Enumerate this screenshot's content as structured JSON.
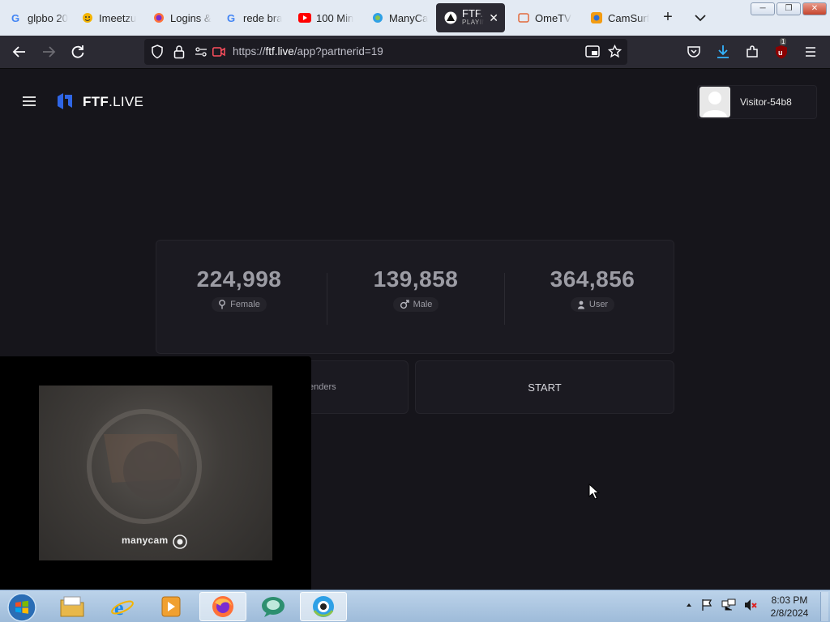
{
  "browser": {
    "tabs": [
      {
        "title": "glpbo 20",
        "icon": "google-icon"
      },
      {
        "title": "Imeetzu",
        "icon": "imeetzu-icon"
      },
      {
        "title": "Logins &",
        "icon": "firefox-icon"
      },
      {
        "title": "rede bra",
        "icon": "google-icon"
      },
      {
        "title": "100 Min",
        "icon": "youtube-icon"
      },
      {
        "title": "ManyCa",
        "icon": "manycam-icon"
      },
      {
        "title": "FTF.li",
        "subtitle": "PLAYING",
        "icon": "ftf-icon",
        "active": true
      },
      {
        "title": "OmeTV",
        "icon": "ometv-icon"
      },
      {
        "title": "CamSurf",
        "icon": "camsurf-icon"
      }
    ],
    "new_tab_label": "+",
    "tab_close_label": "✕",
    "url_prefix": "https://",
    "url_host": "ftf.live",
    "url_path": "/app?partnerid=19",
    "extension_badge": "1",
    "window_controls": {
      "minimize": "─",
      "restore": "❐",
      "close": "✕"
    }
  },
  "app": {
    "logo_bold": "FTF",
    "logo_rest": ".LIVE",
    "visitor_name": "Visitor-54b8",
    "stats": [
      {
        "value": "224,998",
        "label": "Female",
        "icon": "female-icon"
      },
      {
        "value": "139,858",
        "label": "Male",
        "icon": "male-icon"
      },
      {
        "value": "364,856",
        "label": "User",
        "icon": "user-icon"
      }
    ],
    "genders_button_partial": "enders",
    "start_label": "START"
  },
  "video": {
    "watermark": "manycam"
  },
  "taskbar": {
    "time": "8:03 PM",
    "date": "2/8/2024",
    "items": [
      "explorer-icon",
      "ie-icon",
      "media-player-icon",
      "firefox-icon",
      "chat-icon",
      "manycam-icon"
    ]
  },
  "colors": {
    "page_bg": "#16151b",
    "toolbar_bg": "#2b2a33",
    "logo_blue": "#2f66e6"
  }
}
